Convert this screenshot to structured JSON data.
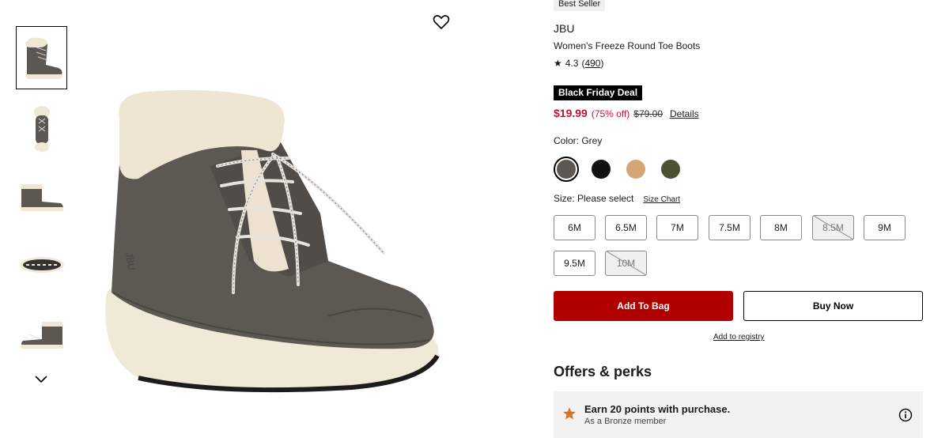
{
  "badge": "Best Seller",
  "brand": "JBU",
  "product_name": "Women's Freeze Round Toe Boots",
  "rating": {
    "value": "4.3",
    "count": "490"
  },
  "deal_label": "Black Friday Deal",
  "price": {
    "current": "$19.99",
    "discount": "(75% off)",
    "original": "$79.00",
    "details_label": "Details"
  },
  "color": {
    "label": "Color: Grey",
    "swatches": [
      {
        "name": "Grey",
        "hex": "#5d5752",
        "selected": true
      },
      {
        "name": "Black",
        "hex": "#111111",
        "selected": false
      },
      {
        "name": "Tan",
        "hex": "#d4a577",
        "selected": false
      },
      {
        "name": "Olive",
        "hex": "#4c5133",
        "selected": false
      }
    ]
  },
  "size": {
    "label": "Size: Please select",
    "chart_label": "Size Chart",
    "options": [
      {
        "label": "6M",
        "available": true
      },
      {
        "label": "6.5M",
        "available": true
      },
      {
        "label": "7M",
        "available": true
      },
      {
        "label": "7.5M",
        "available": true
      },
      {
        "label": "8M",
        "available": true
      },
      {
        "label": "8.5M",
        "available": false
      },
      {
        "label": "9M",
        "available": true
      },
      {
        "label": "9.5M",
        "available": true
      },
      {
        "label": "10M",
        "available": false
      }
    ]
  },
  "actions": {
    "add_to_bag": "Add To Bag",
    "buy_now": "Buy Now",
    "registry": "Add to registry"
  },
  "offers": {
    "heading": "Offers & perks",
    "perk_title": "Earn 20 points with purchase.",
    "perk_subtitle": "As a Bronze member"
  },
  "icons": {
    "favorite": "heart-icon",
    "rating": "star-icon",
    "thumbnails_next": "chevron-down-icon",
    "perk": "star-icon",
    "info": "info-icon"
  },
  "colors": {
    "accent_red": "#c8102e",
    "bag_button": "#b00000",
    "perk_star": "#d1762a"
  }
}
